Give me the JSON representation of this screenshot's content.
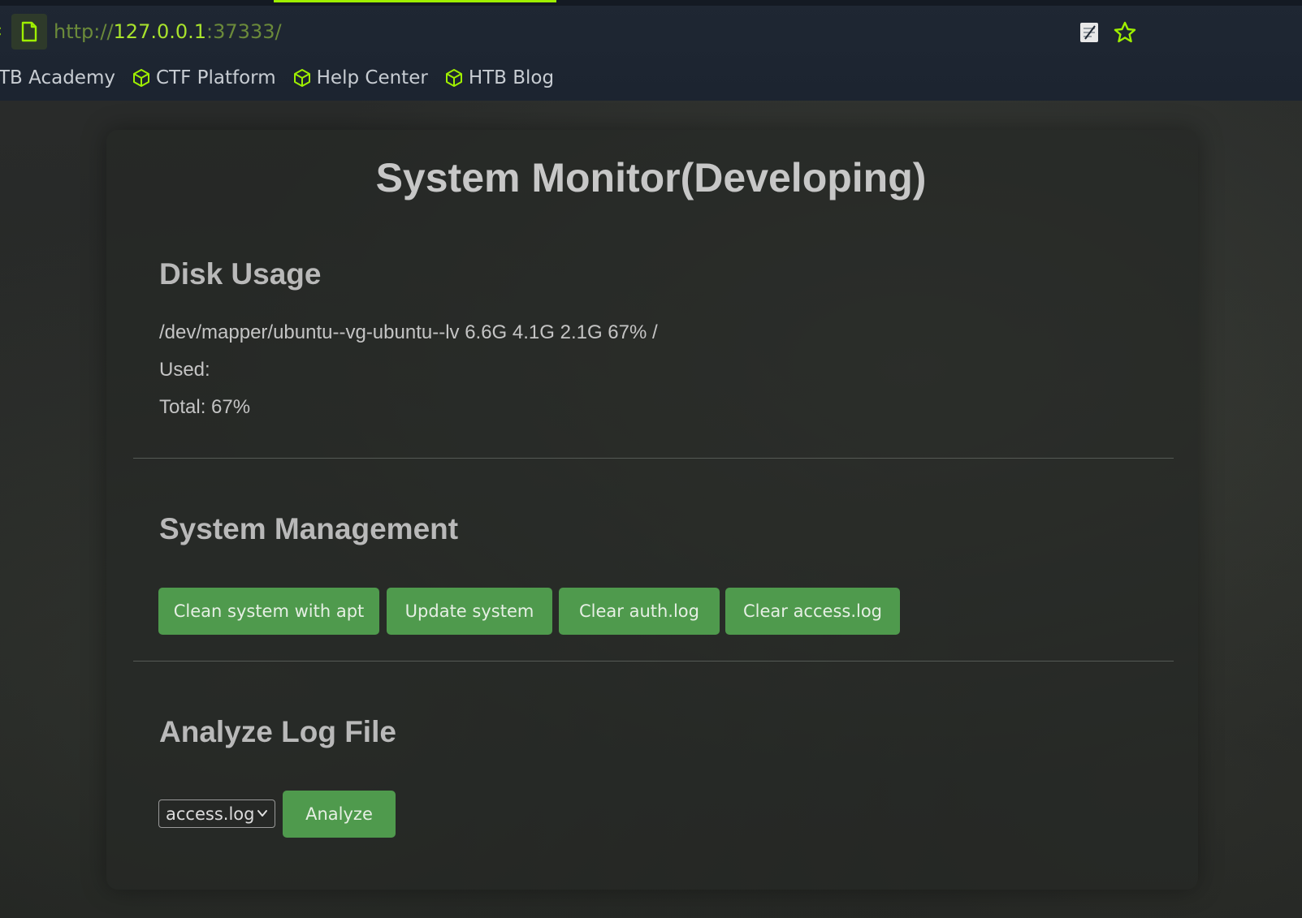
{
  "browser": {
    "url_scheme": "http://",
    "url_host": "127.0.0.1",
    "url_port": ":37333/",
    "bookmarks": [
      {
        "label": "TB Academy"
      },
      {
        "label": "CTF Platform"
      },
      {
        "label": "Help Center"
      },
      {
        "label": "HTB Blog"
      }
    ],
    "accent_color": "#9fef00"
  },
  "page": {
    "title": "System Monitor(Developing)",
    "disk": {
      "heading": "Disk Usage",
      "df_line": "/dev/mapper/ubuntu--vg-ubuntu--lv 6.6G 4.1G 2.1G 67% /",
      "used_line": "Used:",
      "total_line": "Total: 67%"
    },
    "management": {
      "heading": "System Management",
      "buttons": [
        {
          "label": "Clean system with apt"
        },
        {
          "label": "Update system"
        },
        {
          "label": "Clear auth.log"
        },
        {
          "label": "Clear access.log"
        }
      ]
    },
    "analyze": {
      "heading": "Analyze Log File",
      "selected_file": "access.log",
      "button_label": "Analyze"
    },
    "button_color": "#4f9a4d"
  }
}
